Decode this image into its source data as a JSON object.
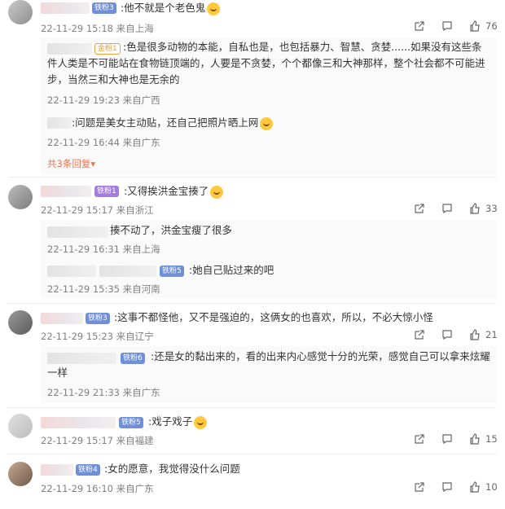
{
  "comments": [
    {
      "badge": "铁粉3",
      "text": ":他不就是个老色鬼",
      "time": "22-11-29 15:18",
      "loc": "来自上海",
      "likes": "76",
      "replies": [
        {
          "badge": "金粉1",
          "text": ":色是很多动物的本能，自私也是，也包括暴力、智慧、贪婪......如果没有这些条件人类是不可能站在食物链顶端的，人要是不贪婪，个个都像三和大神那样，整个社会都不可能进步，当然三和大神也是无余的",
          "time": "22-11-29 19:23",
          "loc": "来自广西"
        },
        {
          "text": ":问题是美女主动贴，还自己把照片晒上网",
          "time": "22-11-29 16:44",
          "loc": "来自广东"
        }
      ],
      "more": "共3条回复"
    },
    {
      "badge": "铁粉1",
      "text": ":又得挨洪金宝揍了",
      "time": "22-11-29 15:17",
      "loc": "来自浙江",
      "likes": "33",
      "replies": [
        {
          "text": "揍不动了，洪金宝瘦了很多",
          "time": "22-11-29 16:31",
          "loc": "来自上海"
        },
        {
          "badge": "铁粉5",
          "text": ":她自己贴过来的吧",
          "time": "22-11-29 15:35",
          "loc": "来自河南"
        }
      ]
    },
    {
      "badge": "铁粉3",
      "text": ":这事不都怪他，又不是强迫的，这俩女的也喜欢，所以，不必大惊小怪",
      "time": "22-11-29 15:23",
      "loc": "来自辽宁",
      "likes": "21",
      "replies": [
        {
          "badge": "铁粉6",
          "text": ":还是女的黏出来的，看的出来内心感觉十分的光荣，感觉自己可以拿来炫耀一样",
          "time": "22-11-29 21:33",
          "loc": "来自广东"
        }
      ]
    },
    {
      "badge": "铁粉5",
      "text": ":戏子戏子",
      "time": "22-11-29 15:17",
      "loc": "来自福建",
      "likes": "15"
    },
    {
      "badge": "铁粉4",
      "text": ":女的愿意，我觉得没什么问题",
      "time": "22-11-29 16:10",
      "loc": "来自广东",
      "likes": "10"
    }
  ],
  "icons": {
    "share": "share-icon",
    "comment": "comment-icon",
    "like": "thumbs-up-icon",
    "expand": "caret-down-icon"
  },
  "colors": {
    "accent": "#eb7350",
    "badge_blue": "#6f8fd8",
    "badge_purple": "#a37ddb",
    "meta": "#808080"
  }
}
